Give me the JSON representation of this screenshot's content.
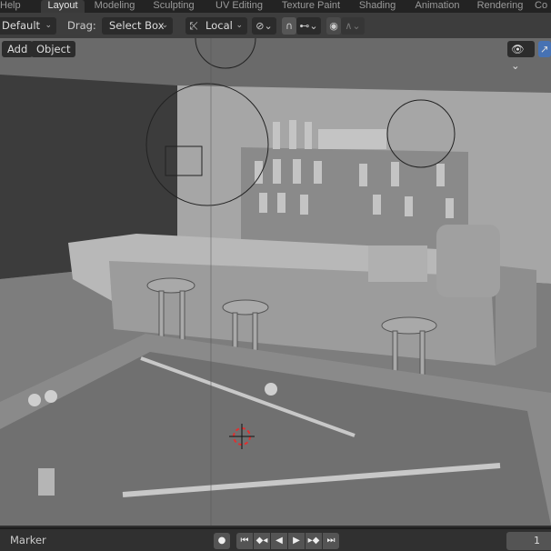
{
  "tabs": {
    "items": [
      "Help",
      "Layout",
      "Modeling",
      "Sculpting",
      "UV Editing",
      "Texture Paint",
      "Shading",
      "Animation",
      "Rendering",
      "Co"
    ],
    "active": "Layout"
  },
  "header": {
    "orientation": "Default",
    "drag_label": "Drag:",
    "drag_value": "Select Box",
    "pivot": "Local",
    "icons": [
      "pivot-icon",
      "snap-magnet-icon",
      "snap-increment-icon",
      "proportional-edit-icon",
      "falloff-curve-icon"
    ]
  },
  "viewport": {
    "menu": {
      "add": "Add",
      "object": "Object"
    },
    "overlay_icons": [
      "visibility-eye-icon",
      "gizmo-icon"
    ]
  },
  "timeline": {
    "marker": "Marker",
    "frame": "1",
    "controls": [
      "record",
      "jump-start",
      "prev-keyframe",
      "play-reverse",
      "play",
      "next-keyframe",
      "jump-end"
    ]
  }
}
